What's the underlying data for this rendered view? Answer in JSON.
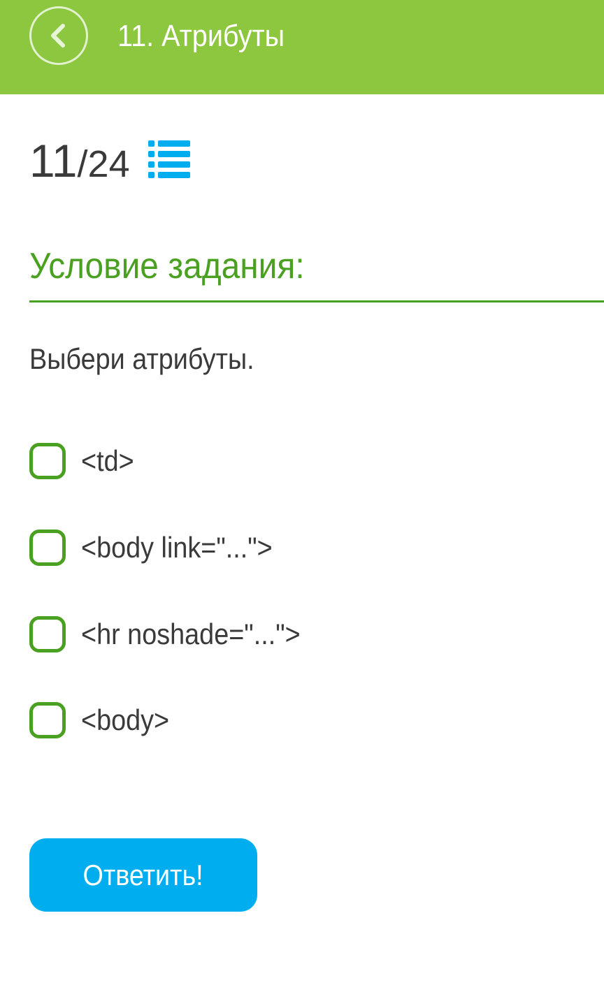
{
  "header": {
    "title": "11. Атрибуты",
    "back_icon": "chevron-left-circle-icon",
    "background_color": "#8dc63f"
  },
  "progress": {
    "current": "11",
    "separator": "/",
    "total": "24",
    "list_icon": "list-icon",
    "list_icon_color": "#00aeef"
  },
  "task": {
    "heading": "Условие задания:",
    "heading_color": "#4aa020",
    "question": "Выбери атрибуты."
  },
  "options": [
    {
      "label": "<td>",
      "checked": false
    },
    {
      "label": "<body link=\"...\">",
      "checked": false
    },
    {
      "label": "<hr noshade=\"...\">",
      "checked": false
    },
    {
      "label": "<body>",
      "checked": false
    }
  ],
  "submit": {
    "label": "Ответить!",
    "color": "#00aeef"
  }
}
